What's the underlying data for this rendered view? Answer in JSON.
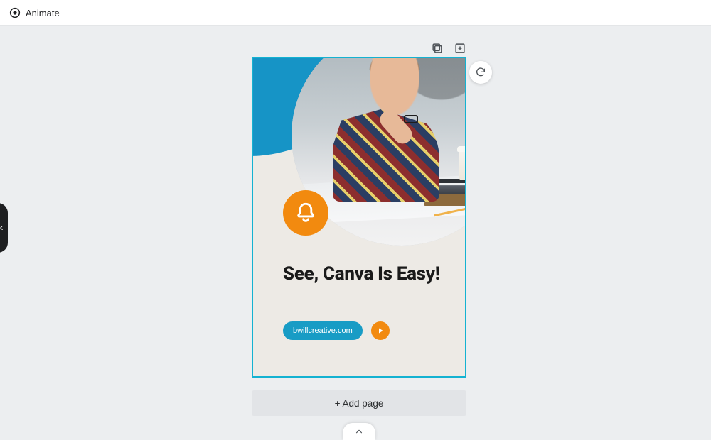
{
  "toolbar": {
    "animate_label": "Animate"
  },
  "design": {
    "headline": "See, Canva Is Easy!",
    "cta_pill": "bwillcreative.com",
    "bell_icon": "bell-icon",
    "play_icon": "play-icon",
    "accent_blue": "#1694c6",
    "accent_orange": "#f28a0f",
    "canvas_bg": "#edeae5",
    "selection_border": "#14b2d1"
  },
  "actions": {
    "add_page_label": "+ Add page"
  },
  "page_tools": {
    "duplicate": "duplicate-page-icon",
    "new_page": "add-page-icon"
  },
  "floating": {
    "regenerate": "regenerate-icon"
  },
  "side_panel_toggle": "collapse-panel-icon",
  "bottom_toggle": "chevron-up-icon"
}
